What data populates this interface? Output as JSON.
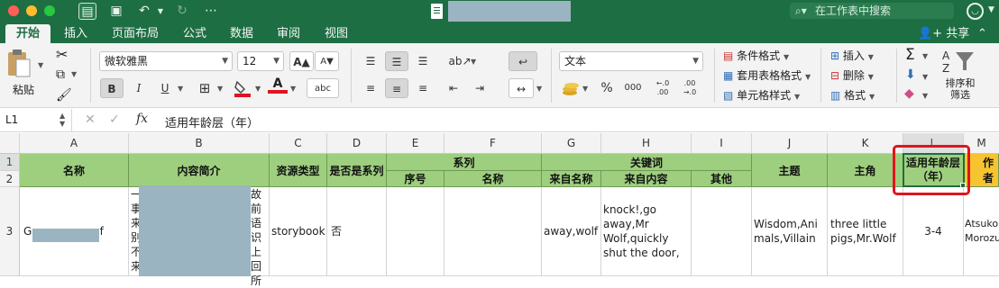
{
  "window": {
    "search_placeholder": "在工作表中搜索"
  },
  "ribbon_tabs": [
    "开始",
    "插入",
    "页面布局",
    "公式",
    "数据",
    "审阅",
    "视图"
  ],
  "share_label": "共享",
  "clipboard": {
    "paste_label": "粘贴"
  },
  "font": {
    "name": "微软雅黑",
    "size": "12",
    "bold": "B",
    "italic": "I",
    "underline": "U",
    "grow": "A▲",
    "shrink": "A▼",
    "phonetic": "abc"
  },
  "number": {
    "format": "文本",
    "percent": "%",
    "comma": "000",
    "inc_decimal": "←.0 .00",
    "dec_decimal": ".00 →.0"
  },
  "styles": {
    "conditional": "条件格式",
    "table": "套用表格格式",
    "cell": "单元格样式"
  },
  "cells_group": {
    "insert": "插入",
    "delete": "删除",
    "format": "格式"
  },
  "editing": {
    "sort_filter_line1": "排序和",
    "sort_filter_line2": "筛选"
  },
  "formula_bar": {
    "name_box": "L1",
    "content": "适用年龄层（年）"
  },
  "columns": [
    "A",
    "B",
    "C",
    "D",
    "E",
    "F",
    "G",
    "H",
    "I",
    "J",
    "K",
    "L",
    "M"
  ],
  "rows": [
    "1",
    "2",
    "3"
  ],
  "headers": {
    "name": "名称",
    "summary": "内容简介",
    "resource_type": "资源类型",
    "is_series": "是否是系列",
    "series": "系列",
    "series_no": "序号",
    "series_name": "名称",
    "keywords": "关键词",
    "from_name": "来自名称",
    "from_content": "来自内容",
    "other": "其他",
    "theme": "主题",
    "protagonist": "主角",
    "age_line1": "适用年龄层",
    "age_line2": "（年）",
    "author": "作者"
  },
  "row3": {
    "name_prefix": "Go",
    "name_suffix": "f",
    "summary_left": [
      "一",
      "事",
      "来",
      "别",
      "不",
      "来"
    ],
    "summary_right": [
      "故",
      "前",
      "语识",
      "上",
      "回",
      "所"
    ],
    "resource_type": "storybook",
    "is_series": "否",
    "from_name": "away,wolf",
    "from_content": "knock!,go away,Mr Wolf,quickly shut the door,",
    "theme": "Wisdom,Animals,Villain",
    "protagonist": "three little pigs,Mr.Wolf",
    "age": "3-4",
    "author": "Atsuko Morozu"
  },
  "colors": {
    "header_green": "#9ecf7f",
    "header_orange": "#f6c431",
    "accent": "#1e6e43",
    "highlight": "#e0141e"
  }
}
